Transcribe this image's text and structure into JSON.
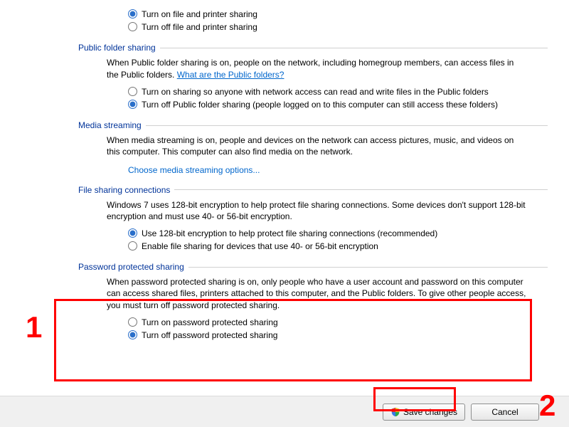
{
  "top_radios": {
    "on": "Turn on file and printer sharing",
    "off": "Turn off file and printer sharing"
  },
  "public_folder": {
    "title": "Public folder sharing",
    "desc_pre": "When Public folder sharing is on, people on the network, including homegroup members, can access files in the Public folders. ",
    "link": "What are the Public folders?",
    "on": "Turn on sharing so anyone with network access can read and write files in the Public folders",
    "off": "Turn off Public folder sharing (people logged on to this computer can still access these folders)"
  },
  "media": {
    "title": "Media streaming",
    "desc": "When media streaming is on, people and devices on the network can access pictures, music, and videos on this computer. This computer can also find media on the network.",
    "action": "Choose media streaming options..."
  },
  "file_conn": {
    "title": "File sharing connections",
    "desc": "Windows 7 uses 128-bit encryption to help protect file sharing connections. Some devices don't support 128-bit encryption and must use 40- or 56-bit encryption.",
    "a": "Use 128-bit encryption to help protect file sharing connections (recommended)",
    "b": "Enable file sharing for devices that use 40- or 56-bit encryption"
  },
  "password": {
    "title": "Password protected sharing",
    "desc": "When password protected sharing is on, only people who have a user account and password on this computer can access shared files, printers attached to this computer, and the Public folders. To give other people access, you must turn off password protected sharing.",
    "on": "Turn on password protected sharing",
    "off": "Turn off password protected sharing"
  },
  "buttons": {
    "save": "Save changes",
    "cancel": "Cancel"
  },
  "annotations": {
    "one": "1",
    "two": "2"
  }
}
